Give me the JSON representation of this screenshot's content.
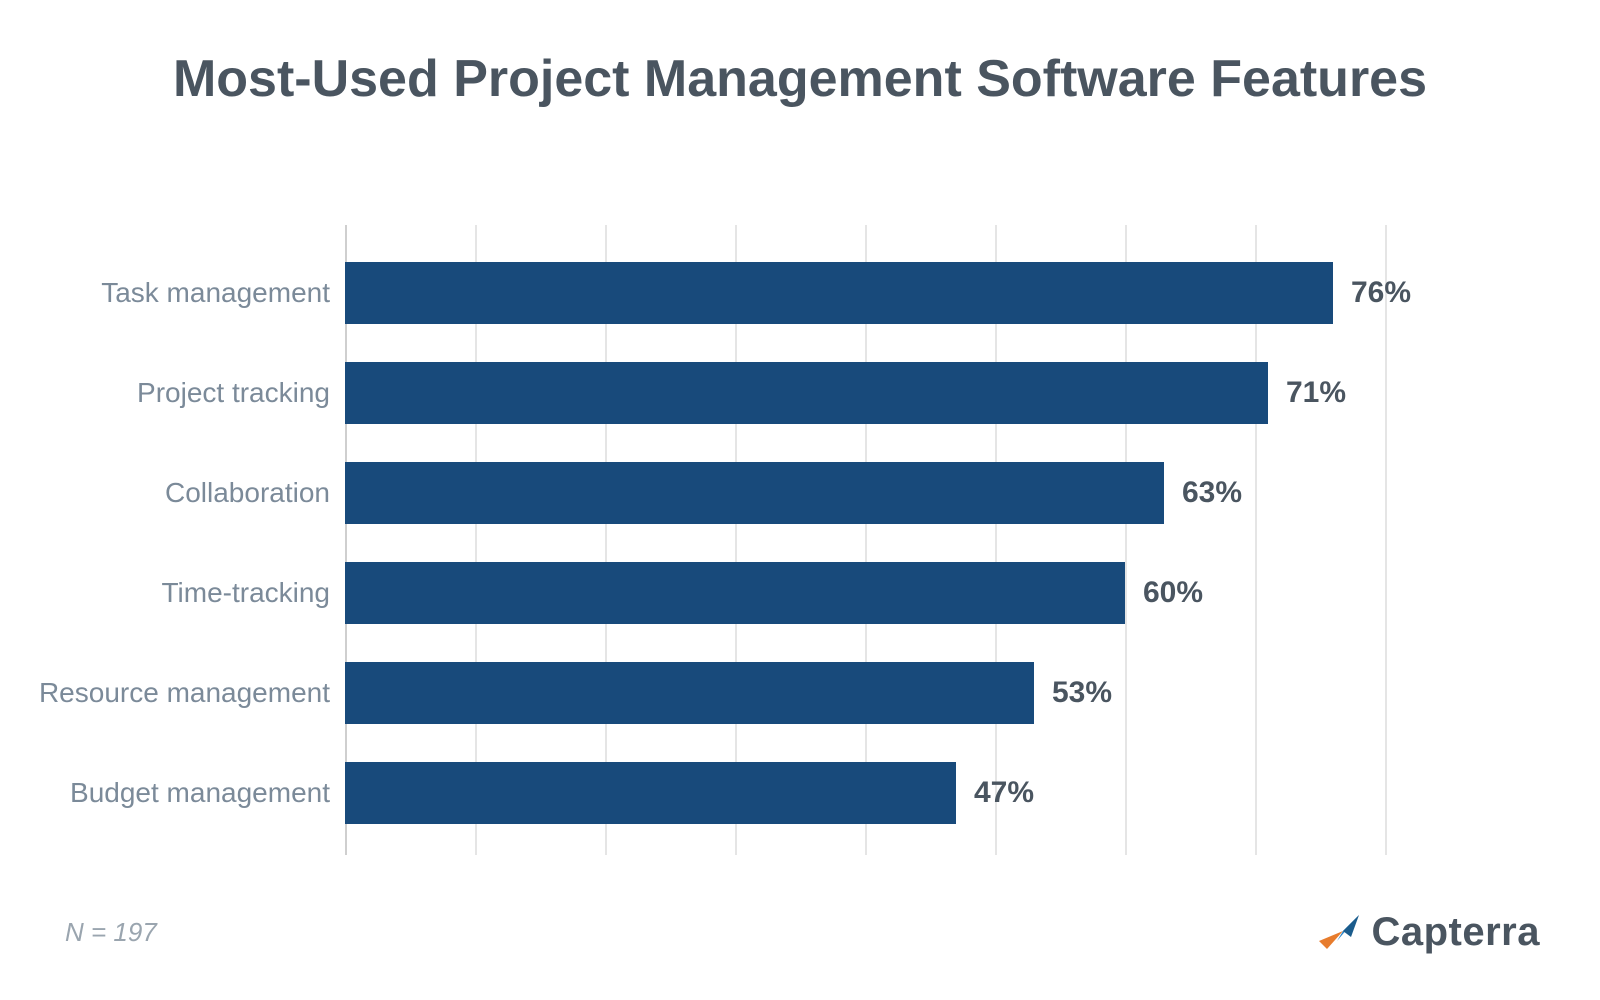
{
  "chart_data": {
    "type": "bar",
    "orientation": "horizontal",
    "title": "Most-Used Project Management Software Features",
    "categories": [
      "Task management",
      "Project tracking",
      "Collaboration",
      "Time-tracking",
      "Resource management",
      "Budget management"
    ],
    "values": [
      76,
      71,
      63,
      60,
      53,
      47
    ],
    "value_suffix": "%",
    "xlim": [
      0,
      80
    ],
    "grid_x_ticks": [
      0,
      10,
      20,
      30,
      40,
      50,
      60,
      70,
      80
    ],
    "bar_color": "#184a7b",
    "footnote": "N = 197",
    "brand": "Capterra"
  }
}
